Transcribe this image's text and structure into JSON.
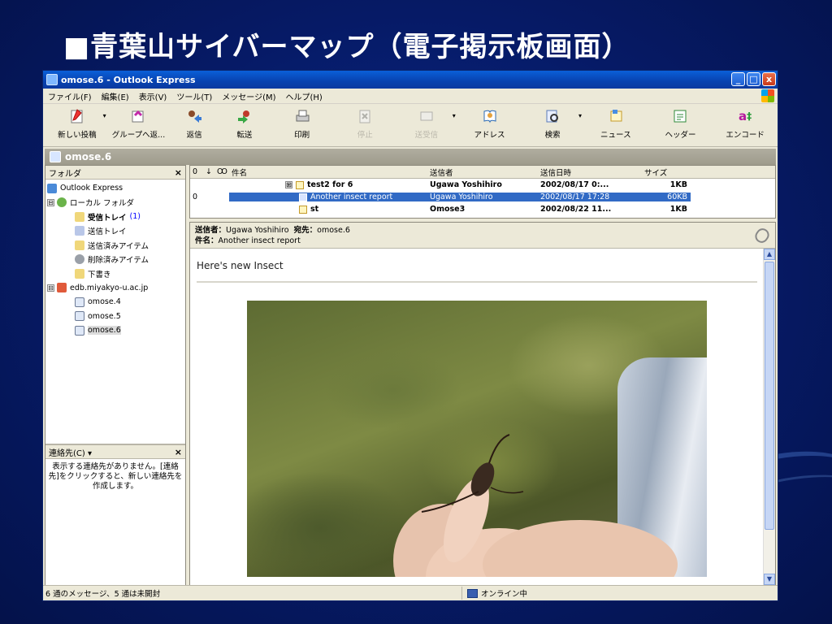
{
  "slide": {
    "title": "■青葉山サイバーマップ（電子掲示板画面）"
  },
  "window": {
    "title": "omose.6 - Outlook Express",
    "buttons": [
      "_",
      "□",
      "x"
    ]
  },
  "menu": [
    "ファイル(F)",
    "編集(E)",
    "表示(V)",
    "ツール(T)",
    "メッセージ(M)",
    "ヘルプ(H)"
  ],
  "toolbar": [
    {
      "label": "新しい投稿",
      "icon": "new-post-icon"
    },
    {
      "label": "グループへ返...",
      "icon": "reply-group-icon"
    },
    {
      "label": "返信",
      "icon": "reply-icon"
    },
    {
      "label": "転送",
      "icon": "forward-icon"
    },
    {
      "label": "印刷",
      "icon": "print-icon"
    },
    {
      "label": "停止",
      "icon": "stop-icon"
    },
    {
      "label": "送受信",
      "icon": "send-receive-icon"
    },
    {
      "label": "アドレス",
      "icon": "address-book-icon"
    },
    {
      "label": "検索",
      "icon": "find-icon"
    },
    {
      "label": "ニュース",
      "icon": "news-icon"
    },
    {
      "label": "ヘッダー",
      "icon": "headers-icon"
    },
    {
      "label": "エンコード",
      "icon": "encoding-icon"
    }
  ],
  "folder_bar": {
    "title": "omose.6"
  },
  "folders": {
    "title": "フォルダ",
    "close": "×",
    "items": [
      {
        "label": "Outlook Express",
        "level": 0
      },
      {
        "label": "ローカル フォルダ",
        "level": 0,
        "expander": "⊟"
      },
      {
        "label": "受信トレイ",
        "level": 1,
        "count": "(1)",
        "bold": true
      },
      {
        "label": "送信トレイ",
        "level": 1
      },
      {
        "label": "送信済みアイテム",
        "level": 1
      },
      {
        "label": "削除済みアイテム",
        "level": 1
      },
      {
        "label": "下書き",
        "level": 1
      },
      {
        "label": "edb.miyakyo-u.ac.jp",
        "level": 0,
        "expander": "⊟"
      },
      {
        "label": "omose.4",
        "level": 1
      },
      {
        "label": "omose.5",
        "level": 1
      },
      {
        "label": "omose.6",
        "level": 1,
        "selected": true
      }
    ]
  },
  "contacts": {
    "title": "連絡先(C) ▾",
    "close": "×",
    "message": "表示する連絡先がありません。[連絡先]をクリックすると、新しい連絡先を作成します。"
  },
  "message_list": {
    "headers": {
      "attach": "0",
      "priority": "↓",
      "flag": "Ꝏ",
      "subject": "件名",
      "from": "送信者",
      "date": "送信日時",
      "size": "サイズ"
    },
    "rows": [
      {
        "attach": "",
        "subject": "test2 for 6",
        "from": "Ugawa Yoshihiro",
        "date": "2002/08/17 0:...",
        "size": "1KB",
        "unread": true,
        "selected": false,
        "expander": "⊞"
      },
      {
        "attach": "0",
        "subject": "Another insect report",
        "from": "Ugawa Yoshihiro",
        "date": "2002/08/17 17:28",
        "size": "60KB",
        "unread": false,
        "selected": true,
        "expander": ""
      },
      {
        "attach": "",
        "subject": "st",
        "from": "Omose3",
        "date": "2002/08/22 11...",
        "size": "1KB",
        "unread": true,
        "selected": false,
        "expander": ""
      }
    ]
  },
  "preview": {
    "from_label": "送信者：",
    "from": "Ugawa Yoshihiro",
    "to_label": "宛先：",
    "to": "omose.6",
    "subject_label": "件名：",
    "subject": "Another insect report",
    "body": "Here's new Insect"
  },
  "status": {
    "messages": "6 通のメッセージ、5 通は未開封",
    "online": "オンライン中"
  },
  "colors": {
    "selection": "#316ac5",
    "titlebar": "#0842b0",
    "slide_bg": "#061a66"
  }
}
